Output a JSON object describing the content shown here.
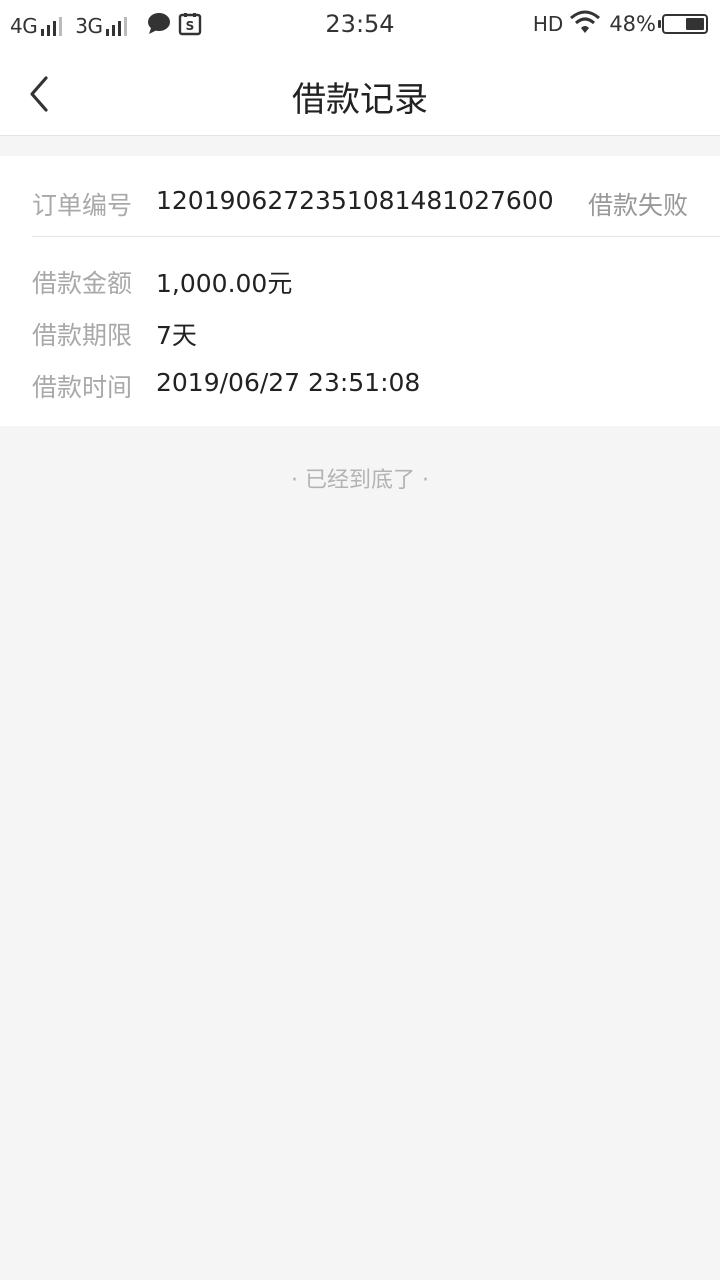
{
  "status_bar": {
    "net1": "4G",
    "net2": "3G",
    "time": "23:54",
    "hd": "HD",
    "battery_text": "48%",
    "battery_level": 0.48
  },
  "nav": {
    "title": "借款记录"
  },
  "record": {
    "order_label": "订单编号",
    "order_number": "1201906272351081481027600",
    "status": "借款失败",
    "amount_label": "借款金额",
    "amount_value": "1,000.00元",
    "term_label": "借款期限",
    "term_value": "7天",
    "time_label": "借款时间",
    "time_value": "2019/06/27 23:51:08"
  },
  "footer": {
    "end_text": "· 已经到底了 ·"
  },
  "colors": {
    "background": "#f5f5f5",
    "card": "#ffffff",
    "label": "#a9a9a9",
    "value": "#222222"
  },
  "icons": {
    "back": "chevron-left-icon",
    "message": "chat-bubble-icon",
    "app": "s-badge-icon",
    "wifi": "wifi-icon",
    "battery": "battery-icon"
  }
}
